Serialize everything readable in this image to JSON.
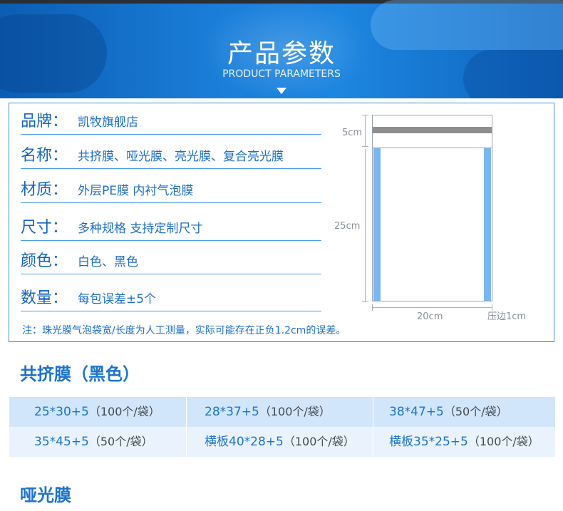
{
  "banner": {
    "title": "产品参数",
    "subtitle": "PRODUCT PARAMETERS"
  },
  "params": {
    "rows": [
      {
        "key": "品牌：",
        "value": "凯牧旗舰店"
      },
      {
        "key": "名称：",
        "value": "共挤膜、哑光膜、亮光膜、复合亮光膜"
      },
      {
        "key": "材质：",
        "value": "外层PE膜  内衬气泡膜"
      },
      {
        "key": "尺寸：",
        "value": "多种规格 支持定制尺寸"
      },
      {
        "key": "颜色：",
        "value": "白色、黑色"
      },
      {
        "key": "数量：",
        "value": "每包误差±5个"
      }
    ],
    "note": "注：珠光膜气泡袋宽/长度为人工测量，实际可能存在正负1.2cm的误差。"
  },
  "diagram": {
    "flap_label": "5cm",
    "length_label": "25cm",
    "width_label": "20cm",
    "edge_label": "压边1cm",
    "edge_color": "#7bb6f3",
    "strip_color": "#8e8e8e"
  },
  "sections": [
    {
      "title": "共挤膜（黑色）"
    },
    {
      "title": "哑光膜"
    }
  ],
  "size_table": {
    "rows": [
      [
        {
          "size": "25*30+5",
          "qty": "（100个/袋）"
        },
        {
          "size": "28*37+5",
          "qty": "（100个/袋）"
        },
        {
          "size": "38*47+5",
          "qty": "（50个/袋）"
        }
      ],
      [
        {
          "size": "35*45+5",
          "qty": "（50个/袋）"
        },
        {
          "size": "横板40*28+5",
          "qty": "（100个/袋）"
        },
        {
          "size": "横板35*25+5",
          "qty": "（100个/袋）"
        }
      ]
    ]
  },
  "colors": {
    "brand_blue": "#1c73cf",
    "banner_blue": "#1b7fda",
    "table_row_dark": "#d2e6fb",
    "table_row_light": "#eaf3fd"
  }
}
